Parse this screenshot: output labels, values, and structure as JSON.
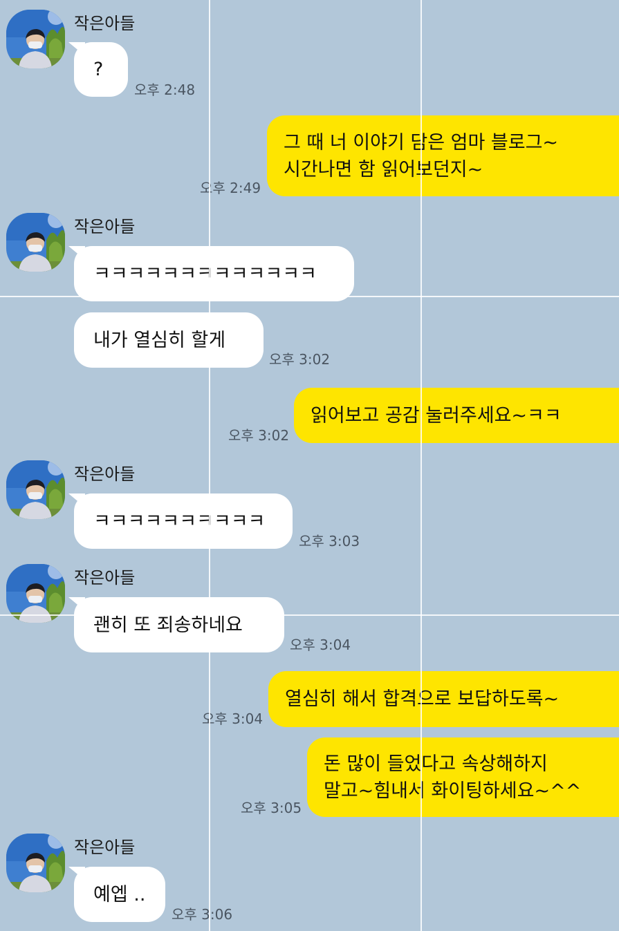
{
  "chat": {
    "contact_name": "작은아들",
    "contact_avatar_icon": "profile-photo-icon",
    "bubble_colors": {
      "incoming": "#ffffff",
      "outgoing": "#fee500",
      "background": "#b2c7d9"
    },
    "messages": [
      {
        "direction": "incoming",
        "sender": "작은아들",
        "text": "?",
        "time": "오후 2:48"
      },
      {
        "direction": "outgoing",
        "lines": [
          "그 때 너 이야기 담은 엄마 블로그~",
          "시간나면 함 읽어보던지~"
        ],
        "time": "오후 2:49"
      },
      {
        "direction": "incoming",
        "sender": "작은아들",
        "text": "ㅋㅋㅋㅋㅋㅋㅋㅋㅋㅋㅋㅋㅋ"
      },
      {
        "direction": "incoming",
        "text": "내가 열심히 할게",
        "time": "오후 3:02"
      },
      {
        "direction": "outgoing",
        "text": "읽어보고 공감 눌러주세요~ㅋㅋ",
        "time": "오후 3:02"
      },
      {
        "direction": "incoming",
        "sender": "작은아들",
        "text": "ㅋㅋㅋㅋㅋㅋㅋㅋㅋㅋ",
        "time": "오후 3:03"
      },
      {
        "direction": "incoming",
        "sender": "작은아들",
        "text": "괜히 또 죄송하네요",
        "time": "오후 3:04"
      },
      {
        "direction": "outgoing",
        "text": "열심히 해서 합격으로 보답하도록~",
        "time": "오후 3:04"
      },
      {
        "direction": "outgoing",
        "lines": [
          "돈 많이 들었다고 속상해하지",
          "말고~힘내서 화이팅하세요~^^"
        ],
        "time": "오후 3:05"
      },
      {
        "direction": "incoming",
        "sender": "작은아들",
        "text": "예엡 ..",
        "time": "오후 3:06"
      }
    ]
  }
}
